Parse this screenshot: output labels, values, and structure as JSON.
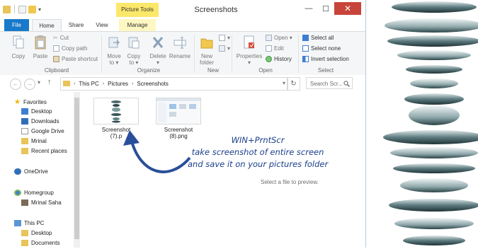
{
  "window": {
    "title": "Screenshots",
    "context_tab_header": "Picture Tools",
    "controls": {
      "minimize": "—",
      "maximize": "☐",
      "close": "✕"
    }
  },
  "tabs": {
    "file": "File",
    "home": "Home",
    "share": "Share",
    "view": "View",
    "manage": "Manage"
  },
  "ribbon": {
    "copy": "Copy",
    "paste": "Paste",
    "cut": "Cut",
    "copy_path": "Copy path",
    "paste_shortcut": "Paste shortcut",
    "move_to_1": "Move",
    "move_to_2": "to ▾",
    "copy_to_1": "Copy",
    "copy_to_2": "to ▾",
    "delete": "Delete",
    "delete_arrow": "▾",
    "rename": "Rename",
    "new_folder_1": "New",
    "new_folder_2": "folder",
    "properties": "Properties",
    "properties_arrow": "▾",
    "open": "Open ▾",
    "edit": "Edit",
    "history": "History",
    "select_all": "Select all",
    "select_none": "Select none",
    "invert_selection": "Invert selection",
    "groups": {
      "clipboard": "Clipboard",
      "organize": "Organize",
      "new": "New",
      "open": "Open",
      "select": "Select"
    }
  },
  "address": {
    "breadcrumbs": [
      "This PC",
      "Pictures",
      "Screenshots"
    ],
    "search_placeholder": "Search Scr..."
  },
  "navpane": {
    "favorites": "Favorites",
    "favorites_items": [
      "Desktop",
      "Downloads",
      "Google Drive",
      "Mrinal",
      "Recent places"
    ],
    "onedrive": "OneDrive",
    "homegroup": "Homegroup",
    "homegroup_items": [
      "Mrinal Saha"
    ],
    "thispc": "This PC",
    "thispc_items": [
      "Desktop",
      "Documents"
    ]
  },
  "files": [
    {
      "name_1": "Screenshot",
      "name_2": "(7).p"
    },
    {
      "name_1": "Screenshot",
      "name_2": "(8).png"
    }
  ],
  "preview_text": "Select a file to preview.",
  "annotation": {
    "line1": "WIN+PrntScr",
    "line2": "take screenshot of entire screen",
    "line3": "and save it on your pictures folder"
  },
  "colors": {
    "file_tab": "#1979ca",
    "context_tab": "#fbe86a",
    "close_button": "#c7443a",
    "annotation": "#1a3f8a"
  }
}
